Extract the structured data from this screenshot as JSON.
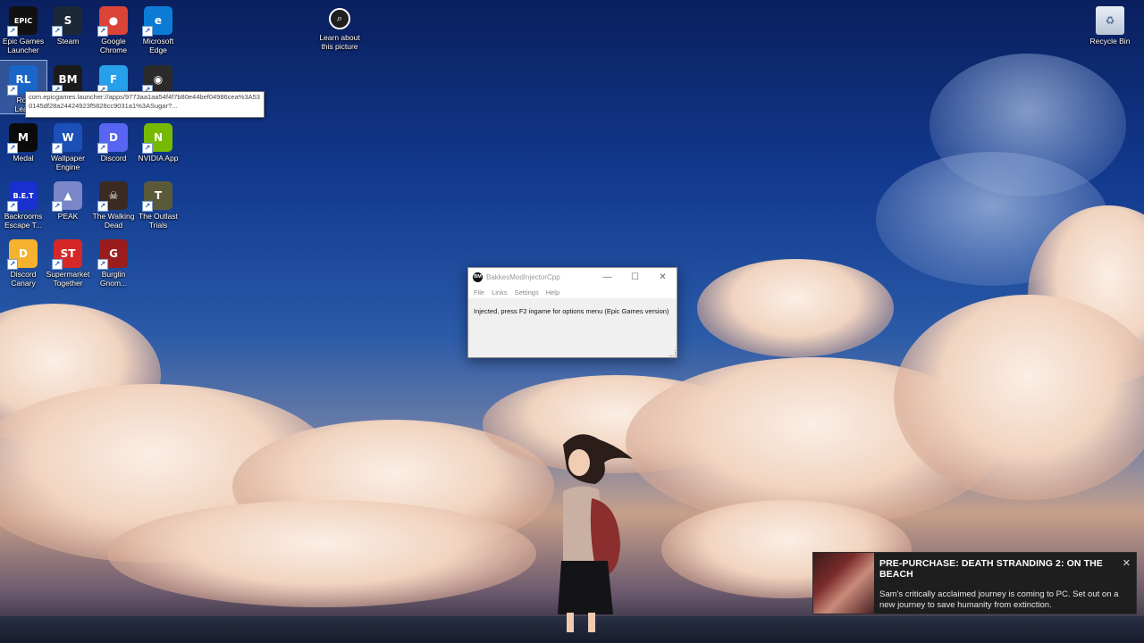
{
  "desktop": {
    "icons": [
      {
        "label": "Epic Games Launcher",
        "glyph": "EPIC",
        "color": "#111111",
        "icon": "epic-games-icon"
      },
      {
        "label": "Steam",
        "glyph": "S",
        "color": "#1b2838",
        "icon": "steam-icon"
      },
      {
        "label": "Google Chrome",
        "glyph": "●",
        "color": "#db4437",
        "icon": "chrome-icon"
      },
      {
        "label": "Microsoft Edge",
        "glyph": "e",
        "color": "#0c7bd6",
        "icon": "edge-icon"
      },
      {
        "label": "Rocket League",
        "glyph": "RL",
        "color": "#1a66c8",
        "icon": "rocket-league-icon"
      },
      {
        "label": "",
        "glyph": "BM",
        "color": "#1b1b1b",
        "icon": "bakkesmod-icon"
      },
      {
        "label": "",
        "glyph": "F",
        "color": "#26a0ea",
        "icon": "fortnite-icon"
      },
      {
        "label": "",
        "glyph": "◉",
        "color": "#2b2b2b",
        "icon": "obs-icon"
      },
      {
        "label": "Medal",
        "glyph": "M",
        "color": "#0b0b0b",
        "icon": "medal-icon"
      },
      {
        "label": "Wallpaper Engine",
        "glyph": "W",
        "color": "#1d4fb8",
        "icon": "wallpaper-engine-icon"
      },
      {
        "label": "Discord",
        "glyph": "D",
        "color": "#5865f2",
        "icon": "discord-icon"
      },
      {
        "label": "NVIDIA App",
        "glyph": "N",
        "color": "#76b900",
        "icon": "nvidia-icon"
      },
      {
        "label": "Backrooms Escape T...",
        "glyph": "B.E.T",
        "color": "#1a2fcf",
        "icon": "backrooms-icon"
      },
      {
        "label": "PEAK",
        "glyph": "▲",
        "color": "#7a86c8",
        "icon": "peak-icon"
      },
      {
        "label": "The Walking Dead",
        "glyph": "☠",
        "color": "#3b2a22",
        "icon": "walking-dead-icon"
      },
      {
        "label": "The Outlast Trials",
        "glyph": "T",
        "color": "#5a5a3a",
        "icon": "outlast-icon"
      },
      {
        "label": "Discord Canary",
        "glyph": "D",
        "color": "#f6b22e",
        "icon": "discord-canary-icon"
      },
      {
        "label": "Supermarket Together",
        "glyph": "ST",
        "color": "#d62828",
        "icon": "supermarket-icon"
      },
      {
        "label": "Burglin Gnom...",
        "glyph": "G",
        "color": "#9a1c1c",
        "icon": "burglin-gnomes-icon"
      }
    ],
    "rocket_league_short": "Roc",
    "rocket_league_short2": "Leag",
    "learn_label": "Learn about this picture",
    "recycle_label": "Recycle Bin"
  },
  "tooltip": {
    "text": "com.epicgames.launcher://apps/9773aa1aa54f4f7b80e44bef04986cea%3A530145df28a24424923f5828cc9031a1%3ASugar?..."
  },
  "injector": {
    "title": "BakkesModInjectorCpp",
    "logo": "BM",
    "menu": [
      "File",
      "Links",
      "Settings",
      "Help"
    ],
    "message": "Injected, press F2 ingame for options menu (Epic Games version)",
    "minimize": "—",
    "maximize": "☐",
    "close": "✕"
  },
  "notification": {
    "title": "PRE-PURCHASE: DEATH STRANDING 2: ON THE BEACH",
    "text": "Sam's critically acclaimed journey is coming to PC. Set out on a new journey to save humanity from extinction.",
    "close": "✕"
  }
}
